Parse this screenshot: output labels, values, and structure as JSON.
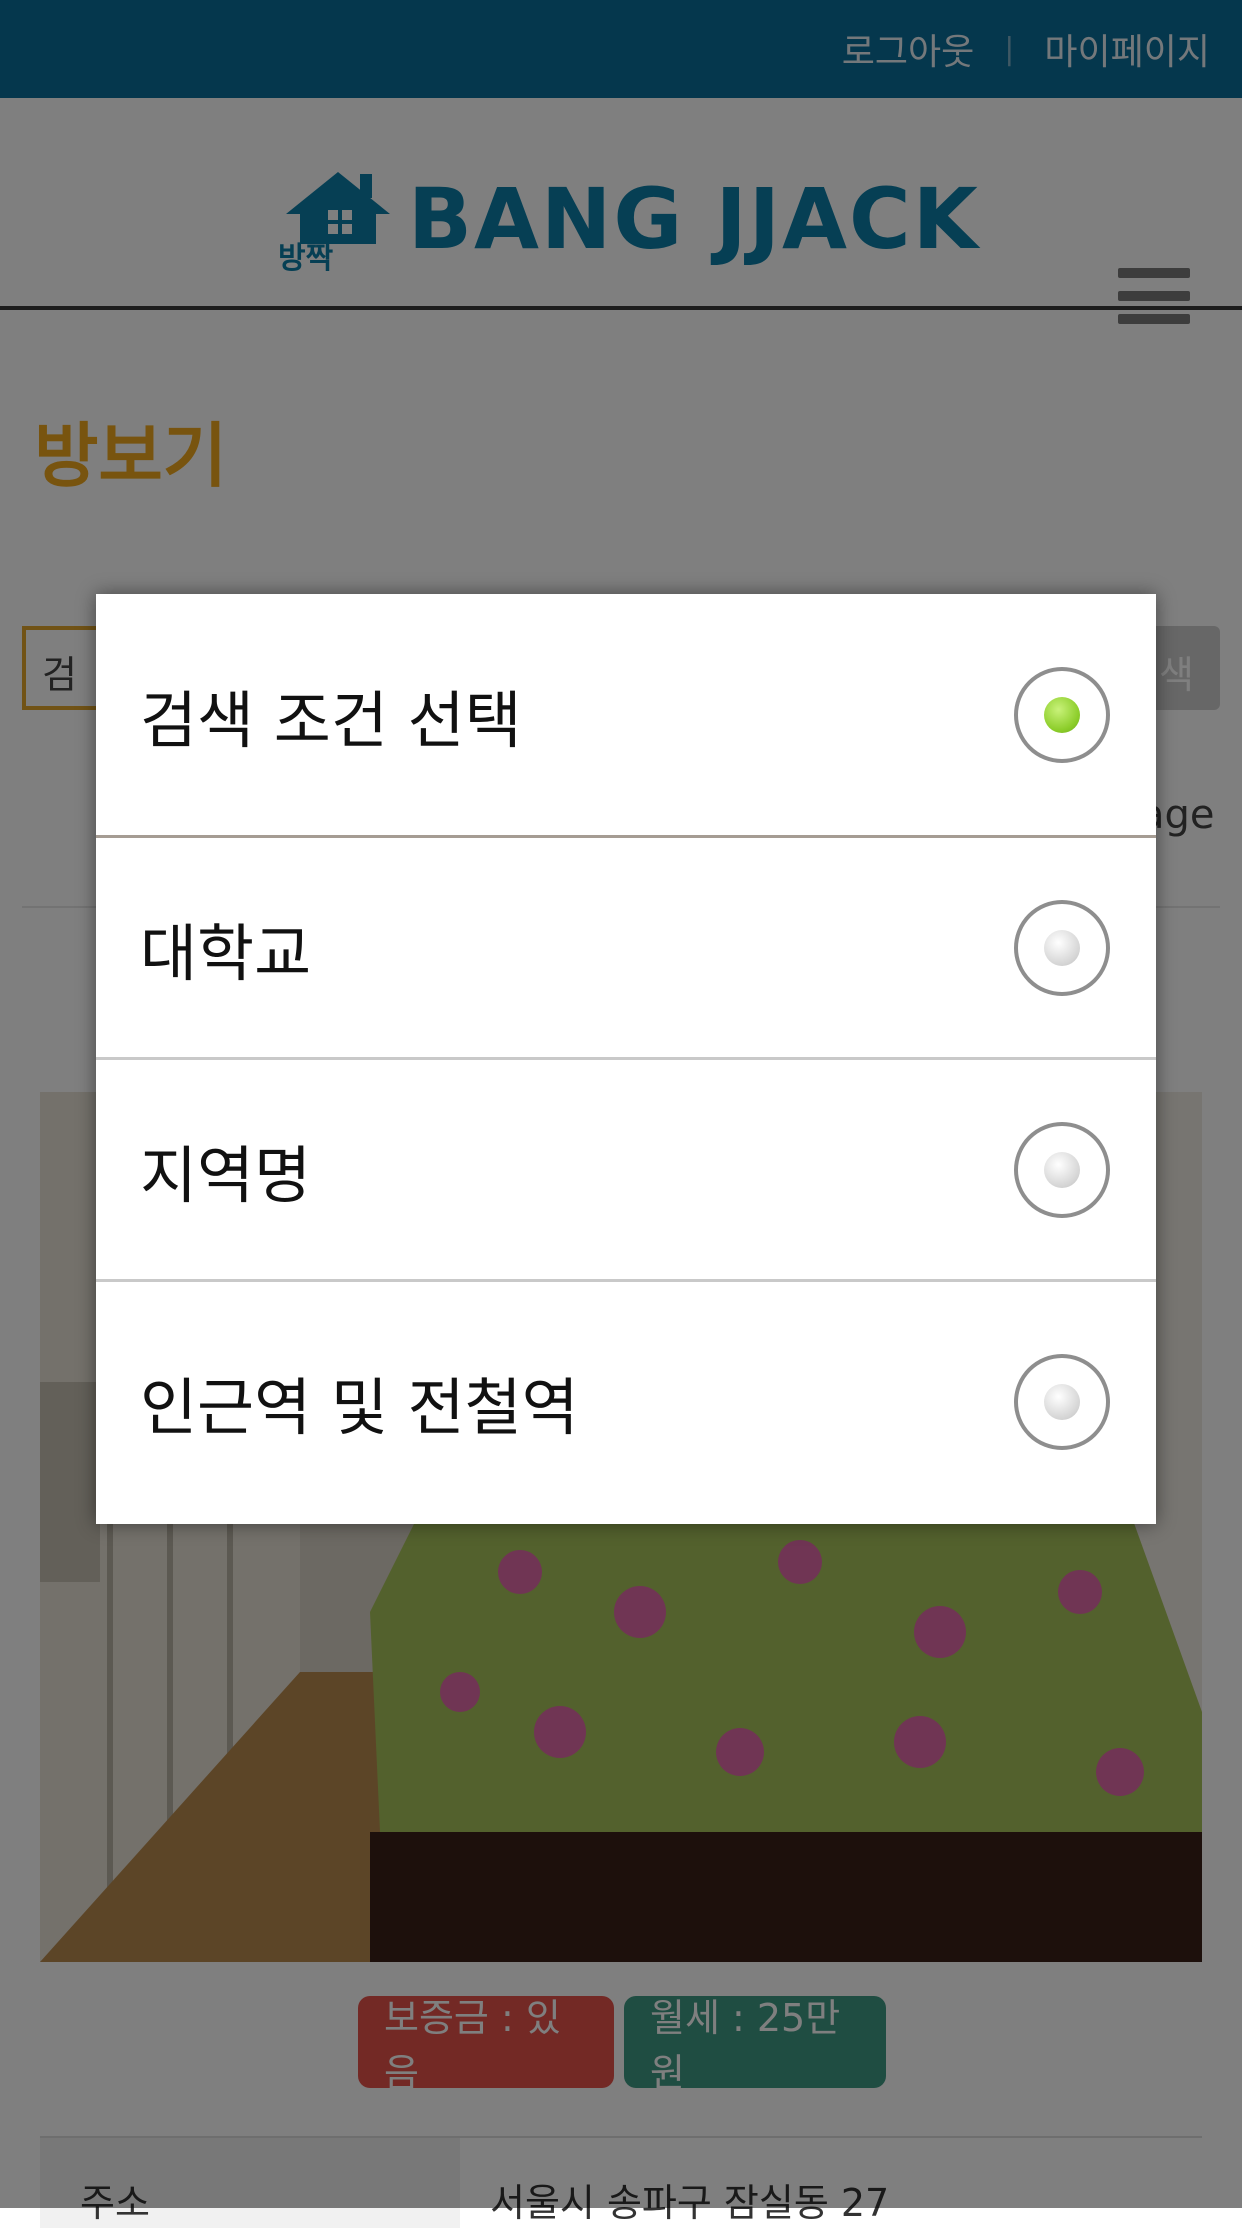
{
  "topbar": {
    "logout": "로그아웃",
    "separator": "|",
    "mypage": "마이페이지"
  },
  "header": {
    "logo_hangul": "방짝",
    "logo_text": "BANG JJACK"
  },
  "page": {
    "title": "방보기",
    "search_select_partial": "검",
    "search_button_partial": "색",
    "page_link_partial": "age"
  },
  "badges": {
    "deposit": "보증금 : 있음",
    "rent": "월세 : 25만원"
  },
  "info": {
    "label": "주소",
    "value": "서울시 송파구 잠실동 27"
  },
  "dialog": {
    "options": [
      {
        "label": "검색 조건 선택",
        "selected": true
      },
      {
        "label": "대학교",
        "selected": false
      },
      {
        "label": "지역명",
        "selected": false
      },
      {
        "label": "인근역 및 전철역",
        "selected": false
      }
    ]
  }
}
